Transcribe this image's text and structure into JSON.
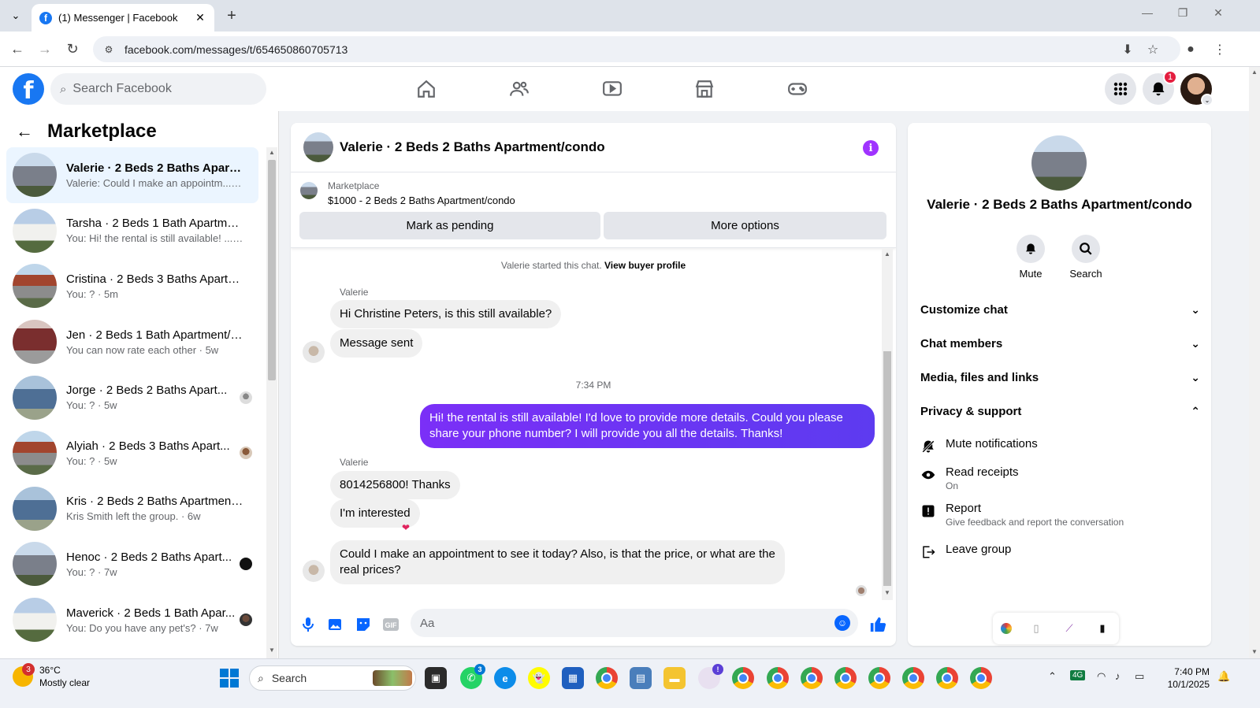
{
  "browser": {
    "tab_title": "(1) Messenger | Facebook",
    "url": "facebook.com/messages/t/654650860705713"
  },
  "fb_header": {
    "search_placeholder": "Search Facebook",
    "notification_count": "1"
  },
  "left_panel": {
    "title": "Marketplace",
    "conversations": [
      {
        "name": "Valerie · 2 Beds 2 Baths Apartm...",
        "preview": "Valerie: Could I make an appointm... · 1m"
      },
      {
        "name": "Tarsha · 2 Beds 1 Bath Apartmen...",
        "preview": "You: Hi! the rental is still available! ... · 5m"
      },
      {
        "name": "Cristina · 2 Beds 3 Baths Apartm...",
        "preview": "You: ? · 5m"
      },
      {
        "name": "Jen · 2 Beds 1 Bath Apartment/c...",
        "preview": "You can now rate each other · 5w"
      },
      {
        "name": "Jorge · 2 Beds 2 Baths Apart...",
        "preview": "You: ? · 5w"
      },
      {
        "name": "Alyiah · 2 Beds 3 Baths Apart...",
        "preview": "You: ? · 5w"
      },
      {
        "name": "Kris · 2 Beds 2 Baths Apartment...",
        "preview": "Kris Smith left the group. · 6w"
      },
      {
        "name": "Henoc · 2 Beds 2 Baths Apart...",
        "preview": "You: ? · 7w"
      },
      {
        "name": "Maverick · 2 Beds 1 Bath Apar...",
        "preview": "You: Do you have any pet's? · 7w"
      }
    ]
  },
  "chat": {
    "title": "Valerie · 2 Beds 2 Baths Apartment/condo",
    "marketplace_label": "Marketplace",
    "listing": "$1000 - 2 Beds 2 Baths Apartment/condo",
    "mark_pending": "Mark as pending",
    "more_options": "More options",
    "started_text": "Valerie started this chat.",
    "view_profile": "View buyer profile",
    "sender_name": "Valerie",
    "msg1": "Hi Christine Peters, is this still available?",
    "msg2": "Message sent",
    "time": "7:34 PM",
    "msg_out": "Hi! the rental is still available! I'd love to provide more details. Could you please share your phone number? I will provide you all the details. Thanks!",
    "msg3": "8014256800! Thanks",
    "msg4": "I'm interested",
    "msg5": "Could I make an appointment to see it today? Also, is that the price, or what are the real prices?",
    "composer_placeholder": "Aa"
  },
  "right_panel": {
    "title": "Valerie · 2 Beds 2 Baths Apartment/condo",
    "mute": "Mute",
    "search": "Search",
    "sections": [
      "Customize chat",
      "Chat members",
      "Media, files and links",
      "Privacy & support"
    ],
    "mute_notifications": "Mute notifications",
    "read_receipts": "Read receipts",
    "read_receipts_status": "On",
    "report": "Report",
    "report_desc": "Give feedback and report the conversation",
    "leave_group": "Leave group"
  },
  "taskbar": {
    "temperature": "36°C",
    "weather": "Mostly clear",
    "weather_badge": "3",
    "search": "Search",
    "whatsapp_badge": "3",
    "time": "7:40 PM",
    "date": "10/1/2025"
  }
}
